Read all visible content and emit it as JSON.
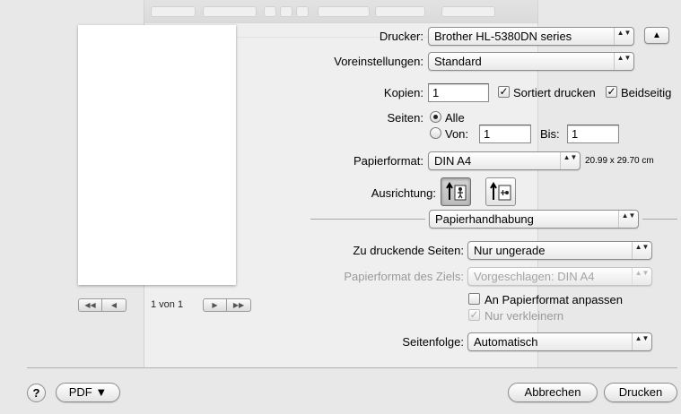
{
  "printer": {
    "label": "Drucker:",
    "value": "Brother HL-5380DN series",
    "arrows": "▲▼",
    "disclosure": "▲"
  },
  "presets": {
    "label": "Voreinstellungen:",
    "value": "Standard",
    "arrows": "▲▼"
  },
  "copies": {
    "label": "Kopien:",
    "value": "1",
    "collate_label": "Sortiert drucken",
    "collate_checked": true,
    "duplex_label": "Beidseitig",
    "duplex_checked": true,
    "check_mark": "✓"
  },
  "pages": {
    "label": "Seiten:",
    "all_label": "Alle",
    "all_selected": true,
    "from_label": "Von:",
    "from_value": "1",
    "to_label": "Bis:",
    "to_value": "1"
  },
  "paper": {
    "label": "Papierformat:",
    "value": "DIN A4",
    "arrows": "▲▼",
    "size_text": "20.99 x 29.70 cm"
  },
  "orientation": {
    "label": "Ausrichtung:",
    "portrait_icon": "portrait-orientation-icon",
    "landscape_icon": "landscape-orientation-icon",
    "selected": "portrait"
  },
  "section": {
    "value": "Papierhandhabung",
    "arrows": "▲▼"
  },
  "pages_to_print": {
    "label": "Zu druckende Seiten:",
    "value": "Nur ungerade",
    "arrows": "▲▼"
  },
  "destination_paper": {
    "label": "Papierformat des Ziels:",
    "value": "Vorgeschlagen: DIN A4",
    "arrows": "▲▼"
  },
  "scale_to_fit": {
    "label": "An Papierformat anpassen",
    "checked": false
  },
  "scale_down_only": {
    "label": "Nur verkleinern",
    "checked": true,
    "check_mark": "✓"
  },
  "page_order": {
    "label": "Seitenfolge:",
    "value": "Automatisch",
    "arrows": "▲▼"
  },
  "preview_nav": {
    "first": "◀◀",
    "prev": "◀",
    "page_text": "1 von 1",
    "next": "▶",
    "last": "▶▶"
  },
  "footer": {
    "help": "?",
    "pdf": "PDF ▼",
    "cancel": "Abbrechen",
    "print": "Drucken"
  },
  "colors": {
    "dialog_bg": "#e8e8e8",
    "disabled_text": "#9a9a9a"
  }
}
